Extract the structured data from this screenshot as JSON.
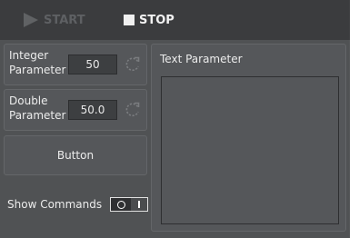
{
  "toolbar": {
    "start_label": "START",
    "stop_label": "STOP"
  },
  "params": {
    "integer": {
      "label": "Integer Parameter",
      "value": "50"
    },
    "double": {
      "label": "Double Parameter",
      "value": "50.0"
    }
  },
  "button": {
    "label": "Button"
  },
  "show_commands": {
    "label": "Show Commands",
    "toggle_state": "off"
  },
  "text_param": {
    "label": "Text Parameter",
    "value": ""
  },
  "colors": {
    "background": "#505254",
    "toolbar": "#3b3c3e",
    "panel": "#55575a",
    "text": "#ececec"
  }
}
